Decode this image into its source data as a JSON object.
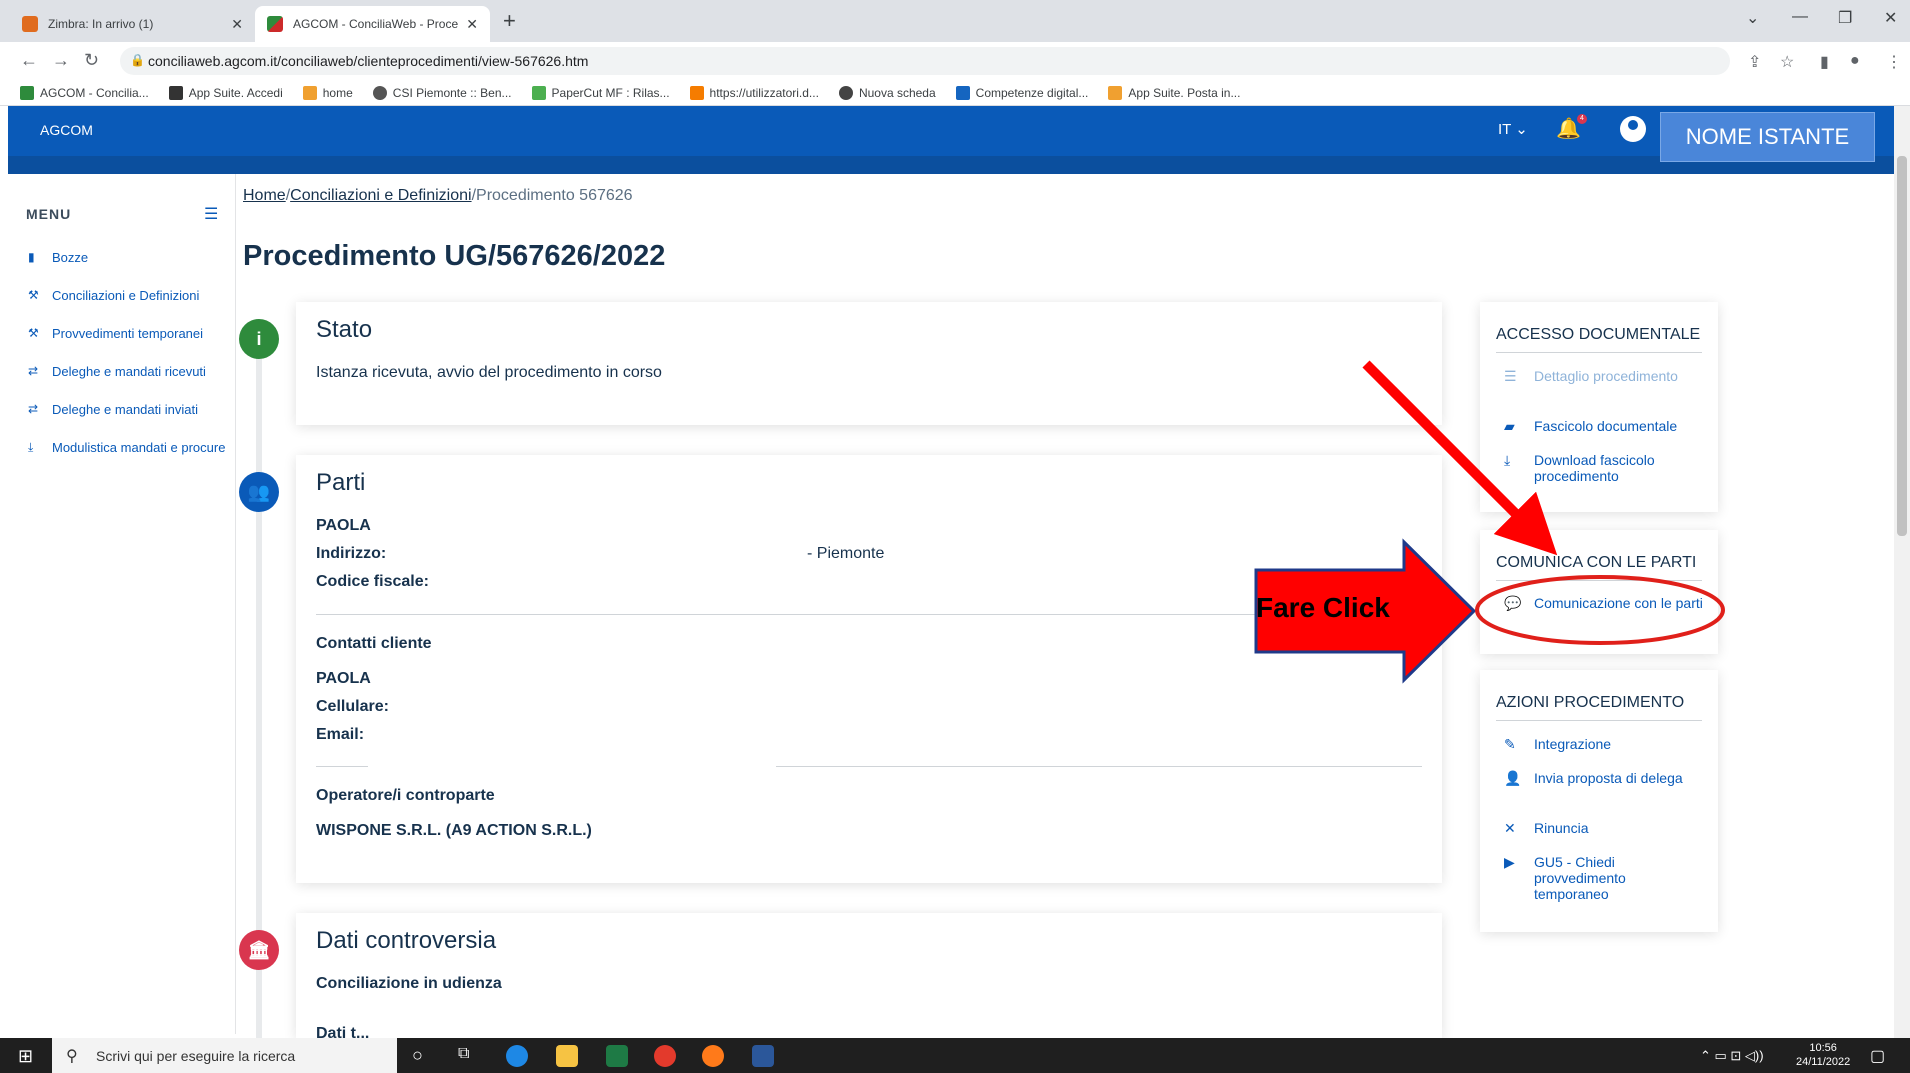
{
  "browser": {
    "tabs": [
      {
        "title": "Zimbra: In arrivo (1)",
        "active": false
      },
      {
        "title": "AGCOM - ConciliaWeb - Procedi",
        "active": true
      }
    ],
    "new_tab": "+",
    "url": "conciliaweb.agcom.it/conciliaweb/clienteprocedimenti/view-567626.htm",
    "bookmarks": [
      "AGCOM - Concilia...",
      "App Suite. Accedi",
      "home",
      "CSI Piemonte :: Ben...",
      "PaperCut MF : Rilas...",
      "https://utilizzatori.d...",
      "Nuova scheda",
      "Competenze digital...",
      "App Suite. Posta in..."
    ]
  },
  "header": {
    "brand": "AGCOM",
    "language": "IT",
    "notification_count": "4",
    "user_name": "NOME ISTANTE"
  },
  "sidebar": {
    "title": "MENU",
    "items": [
      {
        "label": "Bozze",
        "icon": "file-icon"
      },
      {
        "label": "Conciliazioni e Definizioni",
        "icon": "gavel-icon"
      },
      {
        "label": "Provvedimenti temporanei",
        "icon": "gavel-icon"
      },
      {
        "label": "Deleghe e mandati ricevuti",
        "icon": "handshake-icon"
      },
      {
        "label": "Deleghe e mandati inviati",
        "icon": "handshake-icon"
      },
      {
        "label": "Modulistica mandati e procure",
        "icon": "download-icon"
      }
    ]
  },
  "breadcrumb": {
    "home": "Home",
    "section": "Conciliazioni e Definizioni",
    "current": "Procedimento 567626",
    "separator": "/"
  },
  "page": {
    "title": "Procedimento UG/567626/2022"
  },
  "stato": {
    "title": "Stato",
    "text": "Istanza ricevuta, avvio del procedimento in corso"
  },
  "parti": {
    "title": "Parti",
    "name": "PAOLA",
    "address_label": "Indirizzo:",
    "address_suffix": "- Piemonte",
    "fiscal_code_label": "Codice fiscale:",
    "contacts_title": "Contatti cliente",
    "contact_name": "PAOLA",
    "mobile_label": "Cellulare:",
    "email_label": "Email:",
    "operator_title": "Operatore/i controparte",
    "operator_value": "WISPONE S.R.L. (A9 ACTION S.R.L.)"
  },
  "dati": {
    "title": "Dati controversia",
    "text": "Conciliazione in udienza",
    "partial": "Dati t..."
  },
  "panels": {
    "accesso": {
      "title": "ACCESSO DOCUMENTALE",
      "links": [
        {
          "label": "Dettaglio procedimento",
          "icon": "list-icon"
        },
        {
          "label": "Fascicolo documentale",
          "icon": "folder-icon"
        },
        {
          "label": "Download fascicolo procedimento",
          "icon": "download-icon"
        }
      ]
    },
    "comunica": {
      "title": "COMUNICA CON LE PARTI",
      "link": "Comunicazione con le parti"
    },
    "azioni": {
      "title": "AZIONI PROCEDIMENTO",
      "links": [
        {
          "label": "Integrazione",
          "icon": "edit-icon"
        },
        {
          "label": "Invia proposta di delega",
          "icon": "user-icon"
        },
        {
          "label": "Rinuncia",
          "icon": "close-icon"
        },
        {
          "label": "GU5 - Chiedi provvedimento temporaneo",
          "icon": "play-circle-icon"
        }
      ]
    }
  },
  "annotation": {
    "callout": "Fare Click",
    "arrow_color": "#ff0000"
  },
  "taskbar": {
    "search_placeholder": "Scrivi qui per eseguire la ricerca",
    "time": "10:56",
    "date": "24/11/2022"
  }
}
